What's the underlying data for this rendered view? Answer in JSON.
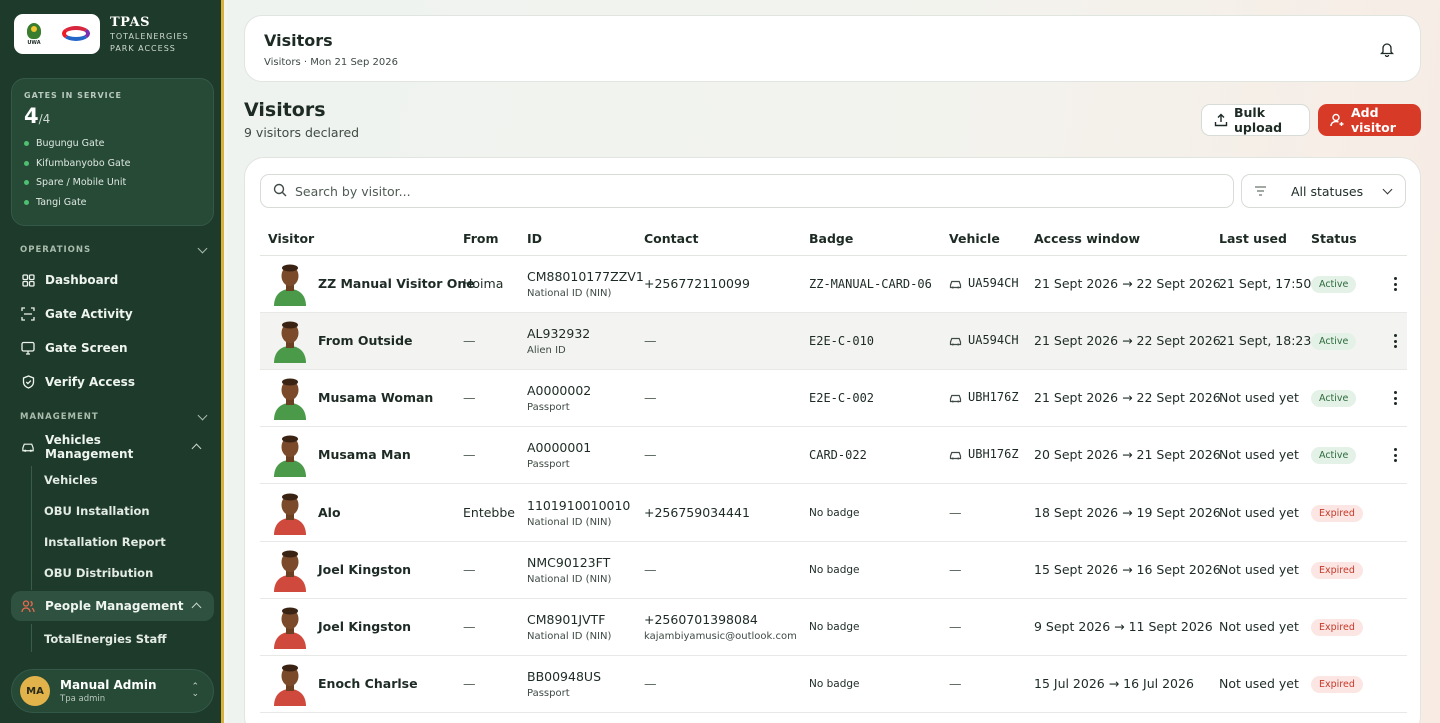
{
  "brand": {
    "logo_uwa_text": "UWA",
    "title": "TPAS",
    "subtitle_1": "TOTALENERGIES",
    "subtitle_2": "PARK ACCESS"
  },
  "gates": {
    "label": "GATES IN SERVICE",
    "count": "4",
    "total": "/4",
    "items": [
      "Bugungu Gate",
      "Kifumbanyobo Gate",
      "Spare / Mobile Unit",
      "Tangi Gate"
    ]
  },
  "nav": {
    "operations_label": "OPERATIONS",
    "operations": [
      "Dashboard",
      "Gate Activity",
      "Gate Screen",
      "Verify Access"
    ],
    "management_label": "MANAGEMENT",
    "vehicles_management": "Vehicles Management",
    "vehicles_sub": [
      "Vehicles",
      "OBU Installation",
      "Installation Report",
      "OBU Distribution"
    ],
    "people_management": "People Management",
    "people_sub": [
      "TotalEnergies Staff"
    ]
  },
  "user": {
    "initials": "MA",
    "name": "Manual Admin",
    "role": "Tpa admin"
  },
  "topbar": {
    "title": "Visitors",
    "crumb": "Visitors · Mon 21 Sep 2026"
  },
  "page": {
    "title": "Visitors",
    "subtitle": "9 visitors declared"
  },
  "actions": {
    "bulk_upload": "Bulk upload",
    "add_visitor": "Add visitor"
  },
  "search": {
    "placeholder": "Search by visitor...",
    "value": ""
  },
  "filter": {
    "selected": "All statuses"
  },
  "table": {
    "headers": [
      "Visitor",
      "From",
      "ID",
      "Contact",
      "Badge",
      "Vehicle",
      "Access window",
      "Last used",
      "Status"
    ],
    "rows": [
      {
        "name": "ZZ Manual Visitor One",
        "from": "Hoima",
        "id": "CM88010177ZZV1",
        "id_type": "National ID (NIN)",
        "contact": "+256772110099",
        "email": "",
        "badge": "ZZ-MANUAL-CARD-06",
        "vehicle": "UA594CH",
        "window": "21 Sept 2026 → 22 Sept 2026",
        "last_used": "21 Sept, 17:50",
        "status": "Active",
        "avatar_color": "#4a9a4a"
      },
      {
        "name": "From Outside",
        "from": "—",
        "id": "AL932932",
        "id_type": "Alien ID",
        "contact": "—",
        "email": "",
        "badge": "E2E-C-010",
        "vehicle": "UA594CH",
        "window": "21 Sept 2026 → 22 Sept 2026",
        "last_used": "21 Sept, 18:23",
        "status": "Active",
        "avatar_color": "#4a9a4a"
      },
      {
        "name": "Musama Woman",
        "from": "—",
        "id": "A0000002",
        "id_type": "Passport",
        "contact": "—",
        "email": "",
        "badge": "E2E-C-002",
        "vehicle": "UBH176Z",
        "window": "21 Sept 2026 → 22 Sept 2026",
        "last_used": "Not used yet",
        "status": "Active",
        "avatar_color": "#4a9a4a"
      },
      {
        "name": "Musama Man",
        "from": "—",
        "id": "A0000001",
        "id_type": "Passport",
        "contact": "—",
        "email": "",
        "badge": "CARD-022",
        "vehicle": "UBH176Z",
        "window": "20 Sept 2026 → 21 Sept 2026",
        "last_used": "Not used yet",
        "status": "Active",
        "avatar_color": "#4a9a4a"
      },
      {
        "name": "Alo",
        "from": "Entebbe",
        "id": "1101910010010",
        "id_type": "National ID (NIN)",
        "contact": "+256759034441",
        "email": "",
        "badge": "No badge",
        "vehicle": "—",
        "window": "18 Sept 2026 → 19 Sept 2026",
        "last_used": "Not used yet",
        "status": "Expired",
        "avatar_color": "#cf4a3c"
      },
      {
        "name": "Joel Kingston",
        "from": "—",
        "id": "NMC90123FT",
        "id_type": "National ID (NIN)",
        "contact": "—",
        "email": "",
        "badge": "No badge",
        "vehicle": "—",
        "window": "15 Sept 2026 → 16 Sept 2026",
        "last_used": "Not used yet",
        "status": "Expired",
        "avatar_color": "#cf4a3c"
      },
      {
        "name": "Joel Kingston",
        "from": "—",
        "id": "CM8901JVTF",
        "id_type": "National ID (NIN)",
        "contact": "+2560701398084",
        "email": "kajambiyamusic@outlook.com",
        "badge": "No badge",
        "vehicle": "—",
        "window": "9 Sept 2026 → 11 Sept 2026",
        "last_used": "Not used yet",
        "status": "Expired",
        "avatar_color": "#cf4a3c"
      },
      {
        "name": "Enoch Charlse",
        "from": "—",
        "id": "BB00948US",
        "id_type": "Passport",
        "contact": "—",
        "email": "",
        "badge": "No badge",
        "vehicle": "—",
        "window": "15 Jul 2026 → 16 Jul 2026",
        "last_used": "Not used yet",
        "status": "Expired",
        "avatar_color": "#cf4a3c"
      }
    ]
  },
  "colors": {
    "sidebar": "#1e3a2a",
    "accent": "#d83a28",
    "active_badge": "#e3f1e6",
    "expired_badge": "#fbe6e3"
  },
  "icons": [
    "bell-icon",
    "upload-icon",
    "add-user-icon",
    "search-icon",
    "filter-icon",
    "chevron-down-icon",
    "car-icon",
    "kebab-menu-icon",
    "dashboard-icon",
    "activity-icon",
    "screen-icon",
    "shield-icon",
    "vehicle-icon",
    "people-icon"
  ]
}
